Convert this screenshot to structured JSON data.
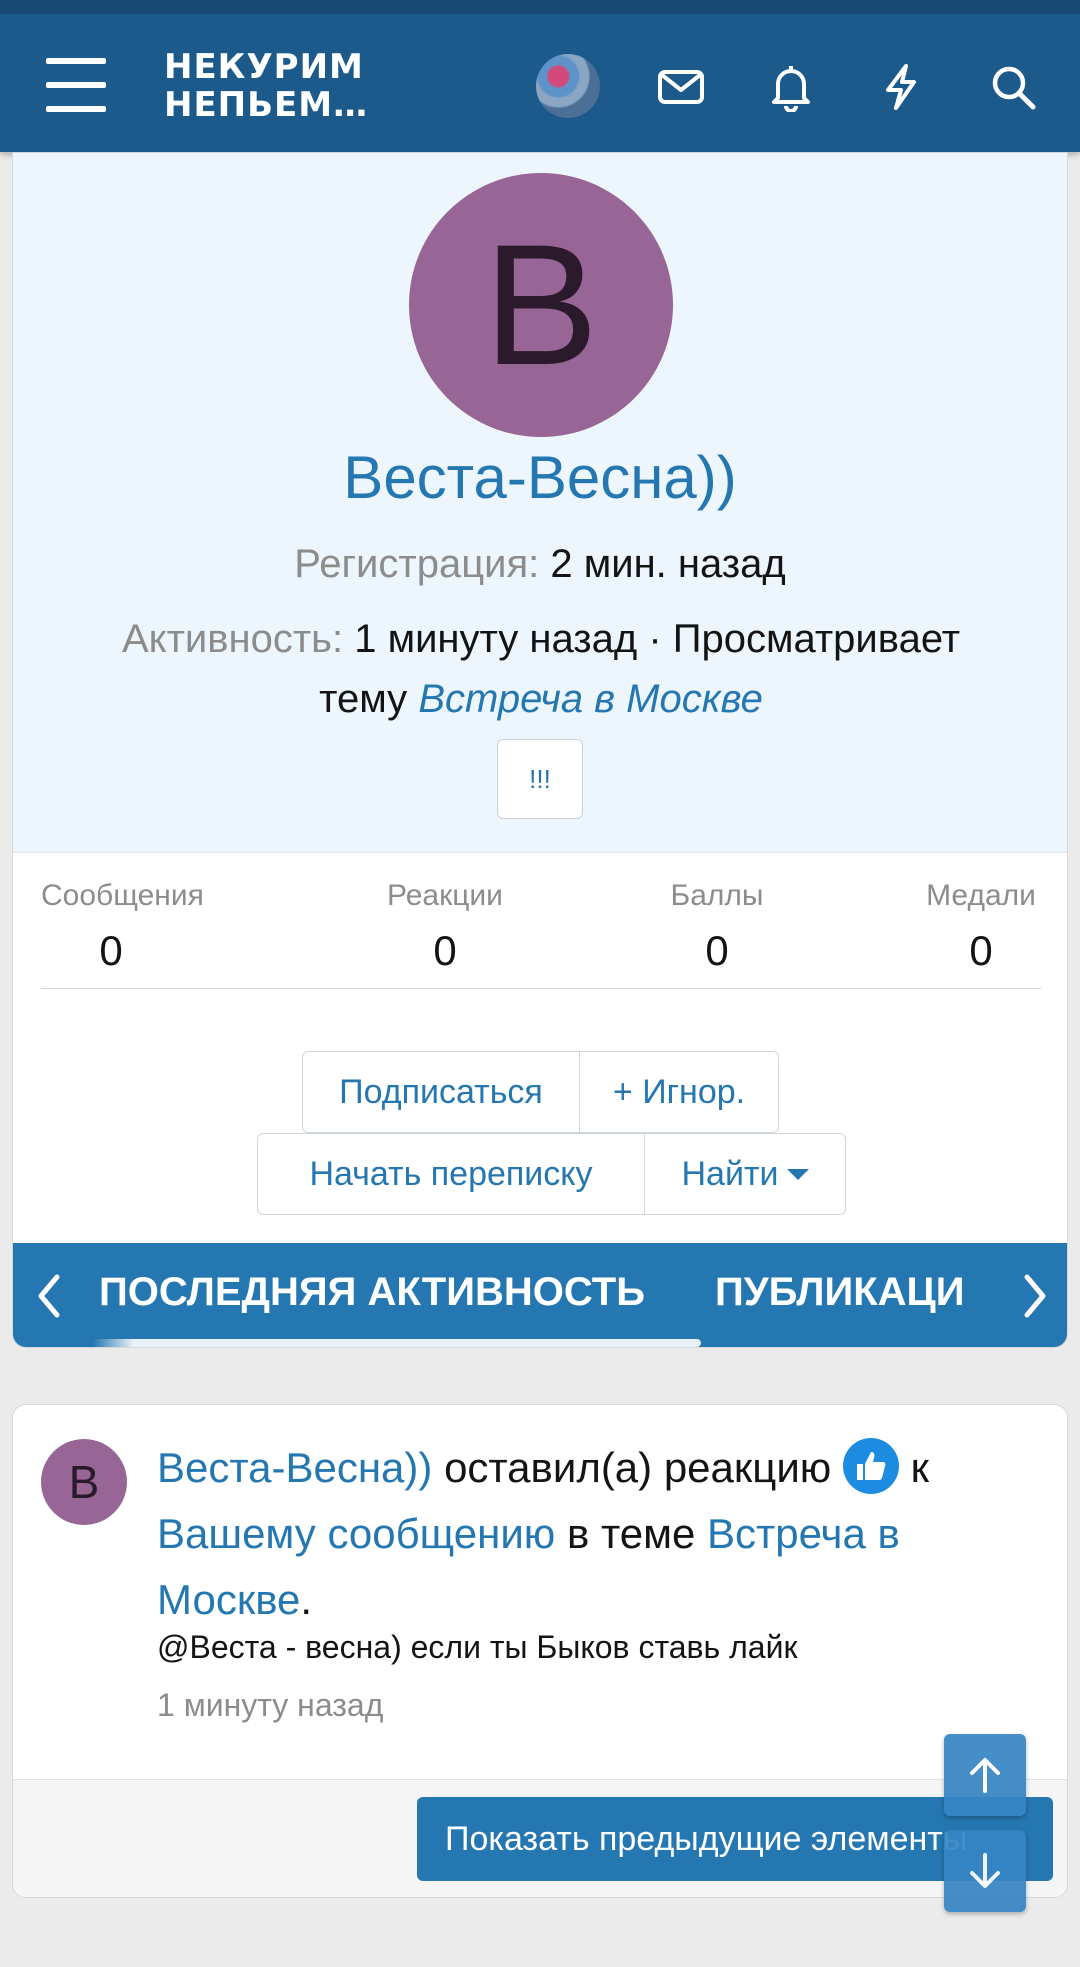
{
  "header": {
    "logo_line1": "НЕКУРИМ",
    "logo_line2": "НЕПЬЕМ…",
    "icons": [
      "menu-icon",
      "avatar",
      "mail-icon",
      "bell-icon",
      "lightning-icon",
      "search-icon"
    ],
    "brand_color": "#1d5a8c"
  },
  "profile": {
    "avatar_letter": "В",
    "avatar_color": "#986696",
    "username": "Веста-Весна))",
    "registration_label": "Регистрация:",
    "registration_value": "2 мин. назад",
    "activity_label": "Активность:",
    "activity_value": "1 минуту назад · Просматривает",
    "activity_topic_prefix": "тему",
    "activity_topic_link": "Встреча в Москве",
    "badge_button": "!!!"
  },
  "stats": [
    {
      "label": "Сообщения",
      "value": "0"
    },
    {
      "label": "Реакции",
      "value": "0"
    },
    {
      "label": "Баллы",
      "value": "0"
    },
    {
      "label": "Медали",
      "value": "0"
    }
  ],
  "actions": {
    "follow": "Подписаться",
    "ignore": "+ Игнор.",
    "start_conversation": "Начать переписку",
    "find": "Найти"
  },
  "tabs": {
    "active": "ПОСЛЕДНЯЯ АКТИВНОСТЬ",
    "next": "ПУБЛИКАЦИ"
  },
  "activity": {
    "avatar_letter": "В",
    "user": "Веста-Весна))",
    "action": "оставил(а) реакцию",
    "to": "к",
    "message_link": "Вашему сообщению",
    "in_topic": "в теме",
    "topic_link": "Встреча в Москве",
    "period": ".",
    "snippet": "@Веста - весна) если ты Быков ставь лайк",
    "time": "1 минуту назад",
    "show_previous": "Показать предыдущие элементы"
  },
  "accent_color": "#2577b1"
}
